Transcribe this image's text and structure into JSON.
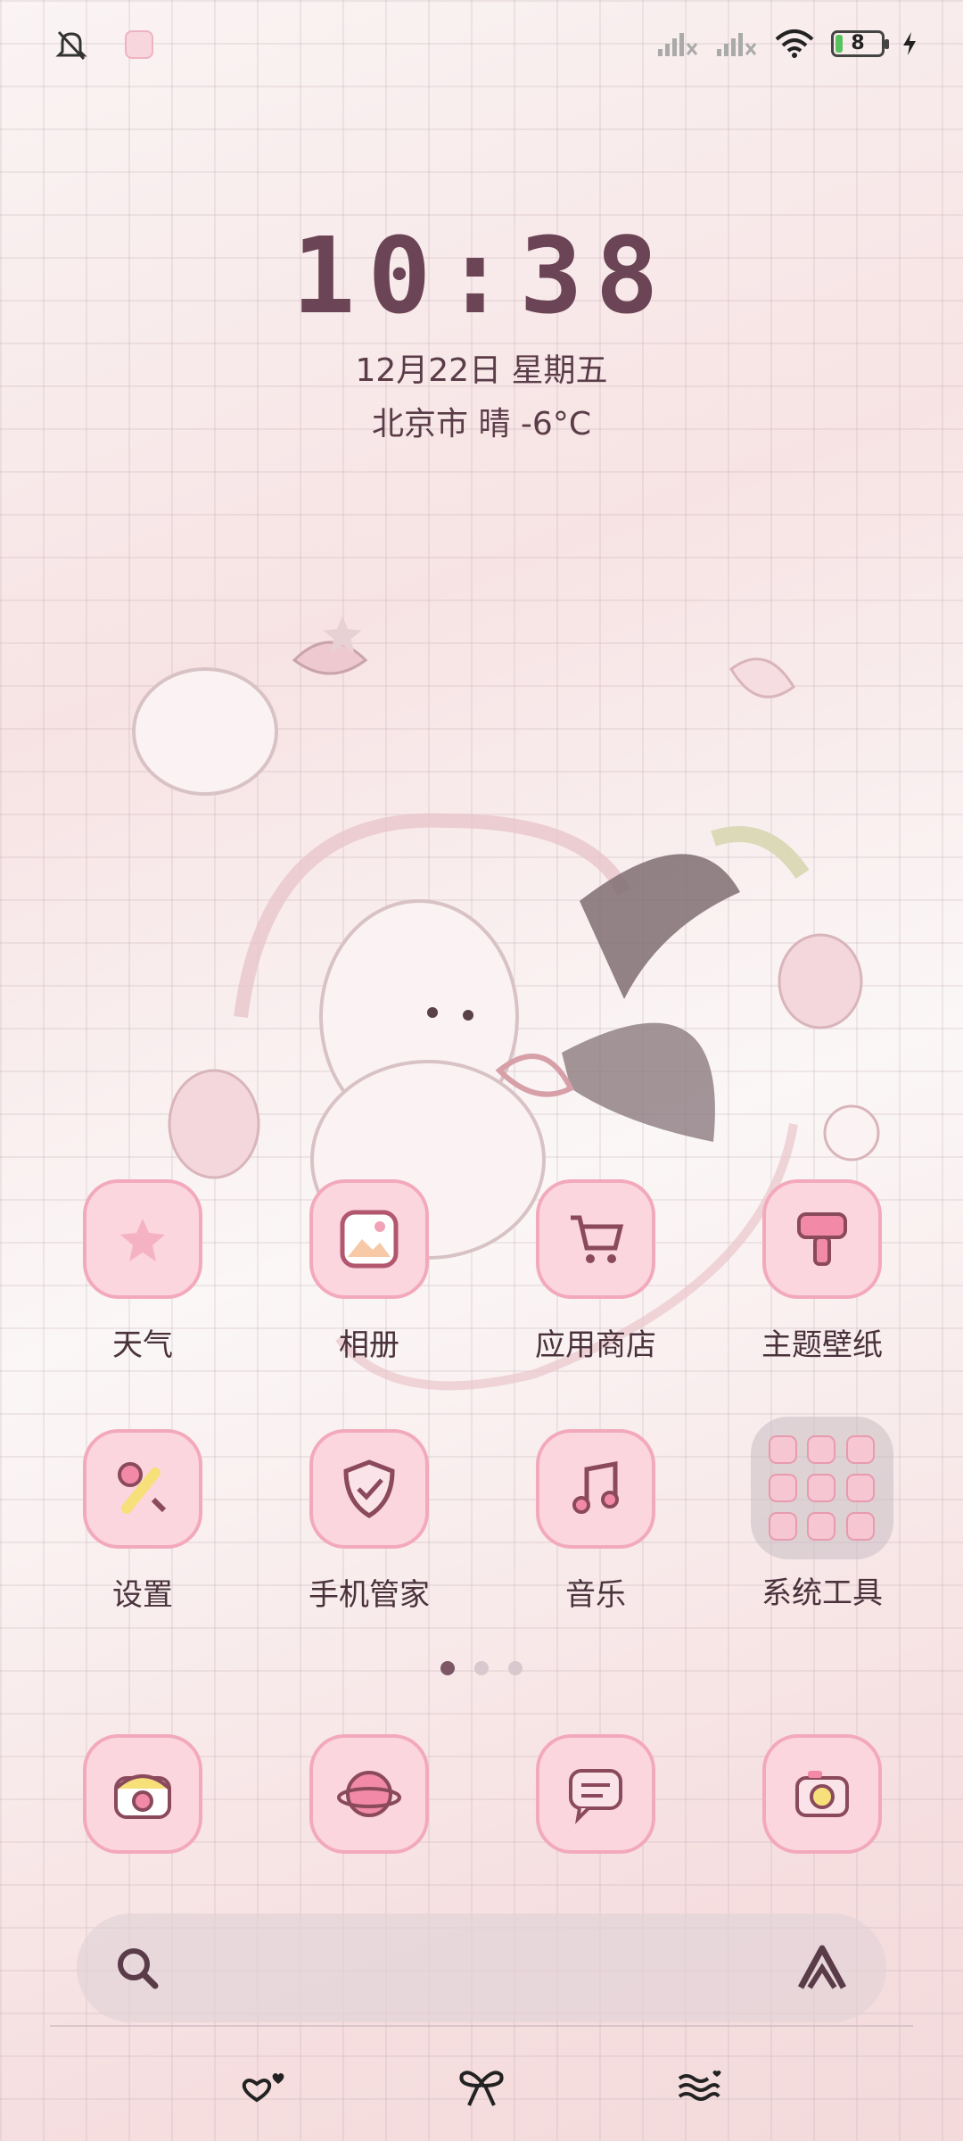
{
  "status_bar": {
    "battery_level": "8",
    "icons": [
      "bell-off-icon",
      "app-notification-icon",
      "signal-icon",
      "signal-icon",
      "wifi-icon",
      "battery-icon",
      "charging-icon"
    ]
  },
  "clock": {
    "time": "10:38",
    "date": "12月22日 星期五",
    "weather": "北京市 晴 -6°C"
  },
  "apps_row1": [
    {
      "label": "天气",
      "icon": "weather-icon"
    },
    {
      "label": "相册",
      "icon": "gallery-icon"
    },
    {
      "label": "应用商店",
      "icon": "app-store-icon"
    },
    {
      "label": "主题壁纸",
      "icon": "theme-icon"
    }
  ],
  "apps_row2": [
    {
      "label": "设置",
      "icon": "settings-icon"
    },
    {
      "label": "手机管家",
      "icon": "security-icon"
    },
    {
      "label": "音乐",
      "icon": "music-icon"
    },
    {
      "label": "系统工具",
      "icon": "folder-icon"
    }
  ],
  "page_indicator": {
    "pages": 3,
    "active": 1
  },
  "dock": [
    {
      "icon": "phone-icon"
    },
    {
      "icon": "browser-icon"
    },
    {
      "icon": "messages-icon"
    },
    {
      "icon": "camera-icon"
    }
  ],
  "colors": {
    "accent": "#f3a9bc",
    "icon_bg": "#fbd6df",
    "text": "#4a323c"
  }
}
